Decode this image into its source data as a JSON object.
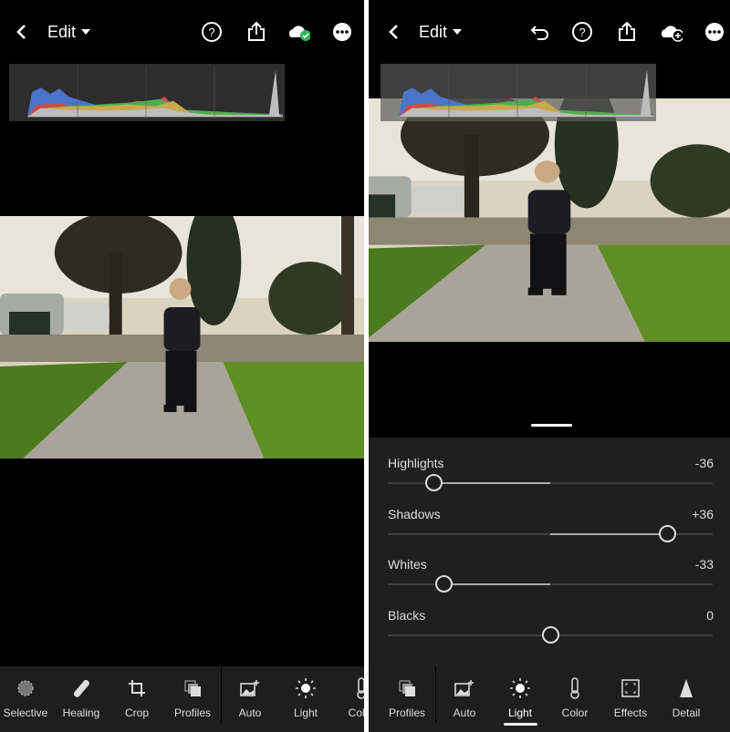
{
  "left_screen": {
    "header": {
      "title": "Edit",
      "icons": [
        "back-chevron",
        "caret-down",
        "help-icon",
        "share-icon",
        "cloud-synced-icon",
        "more-icon"
      ]
    },
    "toolbar": [
      {
        "label": "Selective",
        "icon": "selective-icon"
      },
      {
        "label": "Healing",
        "icon": "bandage-icon"
      },
      {
        "label": "Crop",
        "icon": "crop-icon"
      },
      {
        "label": "Profiles",
        "icon": "profiles-icon"
      },
      {
        "label": "Auto",
        "icon": "auto-icon"
      },
      {
        "label": "Light",
        "icon": "sun-icon"
      },
      {
        "label": "Color",
        "icon": "thermometer-icon"
      }
    ]
  },
  "right_screen": {
    "header": {
      "title": "Edit",
      "icons": [
        "back-chevron",
        "caret-down",
        "undo-icon",
        "help-icon",
        "share-icon",
        "cloud-add-icon",
        "more-icon"
      ]
    },
    "sliders": [
      {
        "label": "Highlights",
        "value": "-36",
        "level": -36
      },
      {
        "label": "Shadows",
        "value": "+36",
        "level": 36
      },
      {
        "label": "Whites",
        "value": "-33",
        "level": -33
      },
      {
        "label": "Blacks",
        "value": "0",
        "level": 0
      }
    ],
    "toolbar": [
      {
        "label": "Profiles",
        "icon": "profiles-icon"
      },
      {
        "label": "Auto",
        "icon": "auto-icon"
      },
      {
        "label": "Light",
        "icon": "sun-icon",
        "active": true
      },
      {
        "label": "Color",
        "icon": "thermometer-icon",
        "modified": true
      },
      {
        "label": "Effects",
        "icon": "effects-icon",
        "modified": true
      },
      {
        "label": "Detail",
        "icon": "detail-icon",
        "modified": true
      }
    ]
  },
  "colors": {
    "panel": "#1f1f1f",
    "toolbar": "#1e1e1e",
    "synced_badge": "#2fb35a"
  }
}
